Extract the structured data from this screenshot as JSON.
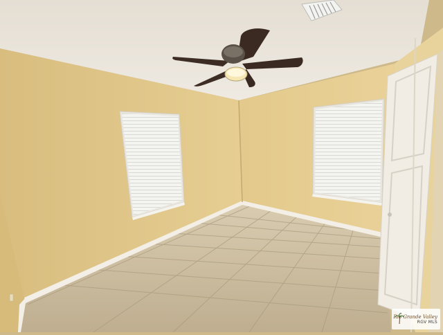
{
  "scene": {
    "description_label": "Empty bedroom with ceiling fan, two windows with blinds, tile floor and white door",
    "colors": {
      "wall": "#e3c98c",
      "wall_shadow": "#cdb077",
      "ceiling": "#ece7de",
      "floor": "#c8b89c",
      "baseboard": "#f2eee6",
      "fan_blade": "#3a2a22",
      "blind": "#f3f3f0",
      "door": "#f1ede4"
    },
    "icons": [
      "ceiling-fan-icon",
      "vent-icon",
      "palm-tree-icon"
    ]
  },
  "watermark": {
    "brand": "Rio Grande Valley",
    "tag": "RGV MLS"
  }
}
